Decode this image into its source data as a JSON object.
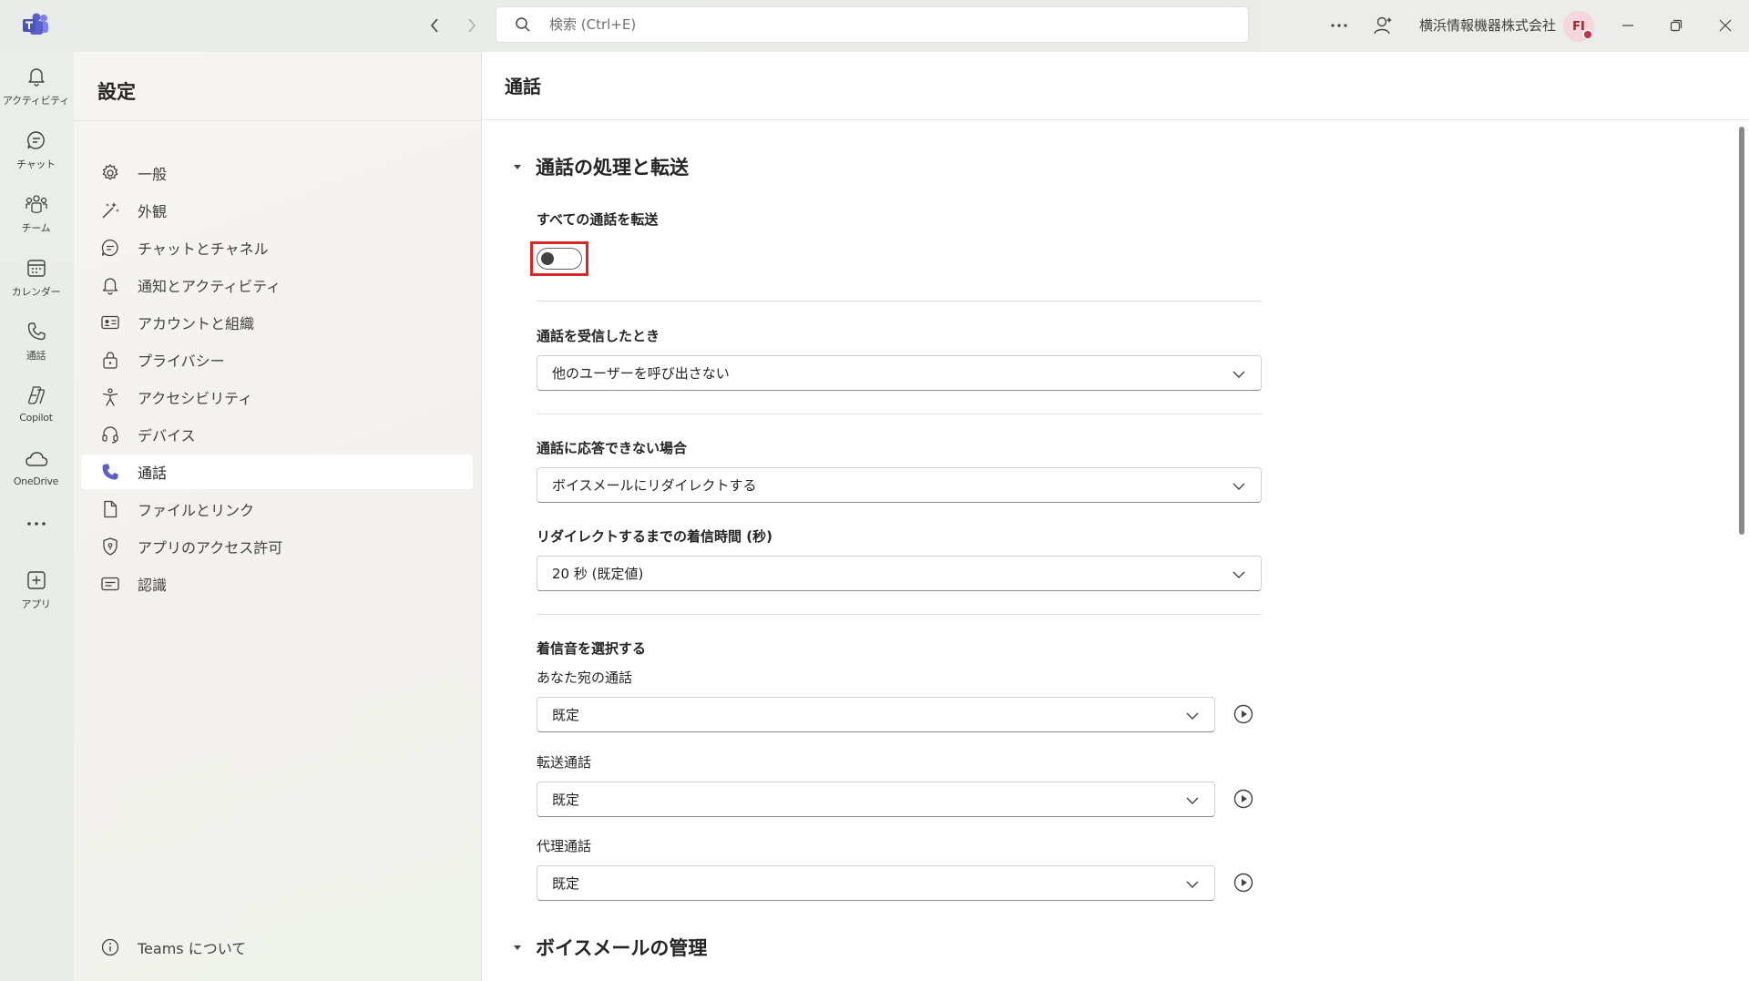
{
  "titlebar": {
    "search_placeholder": "検索 (Ctrl+E)",
    "org_name": "横浜情報機器株式会社",
    "avatar_initials": "FI"
  },
  "rail": {
    "items": [
      {
        "label": "アクティビティ",
        "icon": "bell-icon"
      },
      {
        "label": "チャット",
        "icon": "chat-icon"
      },
      {
        "label": "チーム",
        "icon": "teams-icon"
      },
      {
        "label": "カレンダー",
        "icon": "calendar-icon"
      },
      {
        "label": "通話",
        "icon": "phone-icon"
      },
      {
        "label": "Copilot",
        "icon": "copilot-icon"
      },
      {
        "label": "OneDrive",
        "icon": "cloud-icon"
      },
      {
        "label": "",
        "icon": "more-icon"
      },
      {
        "label": "アプリ",
        "icon": "add-app-icon"
      }
    ]
  },
  "settings": {
    "title": "設定",
    "menu": [
      {
        "label": "一般",
        "icon": "gear-icon"
      },
      {
        "label": "外観",
        "icon": "wand-icon"
      },
      {
        "label": "チャットとチャネル",
        "icon": "chat-icon"
      },
      {
        "label": "通知とアクティビティ",
        "icon": "bell-icon"
      },
      {
        "label": "アカウントと組織",
        "icon": "id-card-icon"
      },
      {
        "label": "プライバシー",
        "icon": "lock-icon"
      },
      {
        "label": "アクセシビリティ",
        "icon": "accessibility-icon"
      },
      {
        "label": "デバイス",
        "icon": "headset-icon"
      },
      {
        "label": "通話",
        "icon": "phone-icon"
      },
      {
        "label": "ファイルとリンク",
        "icon": "file-icon"
      },
      {
        "label": "アプリのアクセス許可",
        "icon": "shield-icon"
      },
      {
        "label": "認識",
        "icon": "captions-icon"
      }
    ],
    "about": "Teams について"
  },
  "main": {
    "title": "通話",
    "section1": {
      "title": "通話の処理と転送",
      "forward_all_label": "すべての通話を転送",
      "forward_all_on": false,
      "on_receive_label": "通話を受信したとき",
      "on_receive_value": "他のユーザーを呼び出さない",
      "unanswered_label": "通話に応答できない場合",
      "unanswered_value": "ボイスメールにリダイレクトする",
      "ring_time_label": "リダイレクトするまでの着信時間 (秒)",
      "ring_time_value": "20 秒 (既定値)",
      "ringtone_label": "着信音を選択する",
      "ringtones": [
        {
          "label": "あなた宛の通話",
          "value": "既定"
        },
        {
          "label": "転送通話",
          "value": "既定"
        },
        {
          "label": "代理通話",
          "value": "既定"
        }
      ]
    },
    "section2": {
      "title": "ボイスメールの管理"
    }
  },
  "colors": {
    "accent": "#5b5fc7",
    "highlight": "#d7262c"
  }
}
